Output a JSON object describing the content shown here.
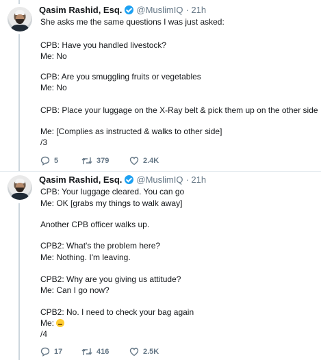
{
  "tweets": [
    {
      "author": "Qasim Rashid, Esq.",
      "handle": "@MuslimIQ",
      "time": "· 21h",
      "lines": [
        "She asks me the same questions I was just asked:",
        "CPB: Have you handled livestock?",
        "Me: No",
        "CPB: Are you smuggling fruits or vegetables",
        "Me: No",
        "CPB: Place your luggage on the X-Ray belt & pick them up on the other side",
        "Me: [Complies as instructed & walks to other side]",
        "/3"
      ],
      "replies": "5",
      "retweets": "379",
      "likes": "2.4K"
    },
    {
      "author": "Qasim Rashid, Esq.",
      "handle": "@MuslimIQ",
      "time": "· 21h",
      "lines": [
        "CPB: Your luggage cleared. You can go",
        "Me: OK [grabs my things to walk away]",
        "Another CPB officer walks up.",
        "CPB2: What's the problem here?",
        "Me: Nothing. I'm leaving.",
        "CPB2: Why are you giving us attitude?",
        "Me: Can I go now?",
        "CPB2: No. I need to check your bag again",
        "Me:",
        "/4"
      ],
      "emoji": "expressionless-face-emoji",
      "replies": "17",
      "retweets": "416",
      "likes": "2.5K"
    }
  ],
  "colors": {
    "verified": "#1da1f2",
    "meta_gray": "#657786",
    "thread_line": "#ccd6dd"
  }
}
